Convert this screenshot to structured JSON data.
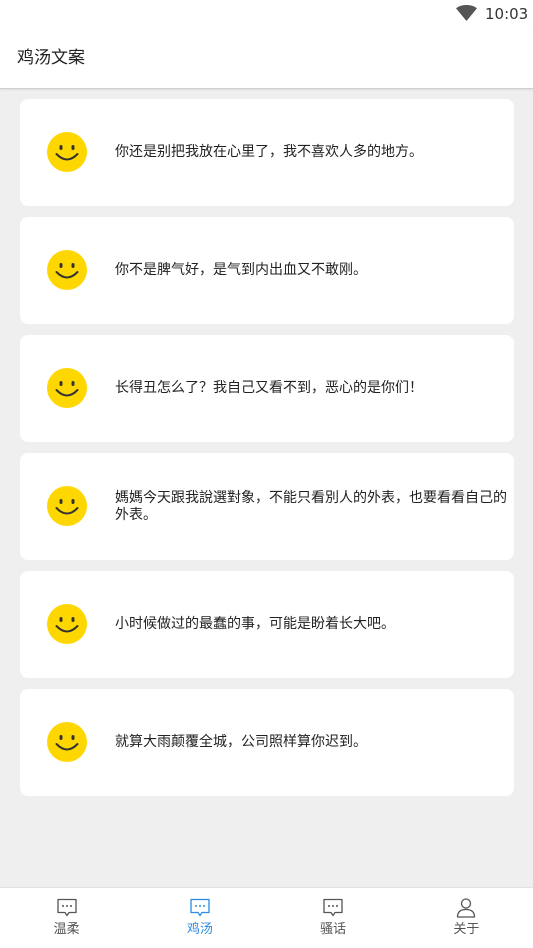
{
  "status_bar": {
    "time": "10:03",
    "wifi_icon": "wifi-icon"
  },
  "header": {
    "title": "鸡汤文案"
  },
  "cards": [
    {
      "icon": "smiley-icon",
      "text": "你还是别把我放在心里了，我不喜欢人多的地方。"
    },
    {
      "icon": "smiley-icon",
      "text": "你不是脾气好，是气到内出血又不敢刚。"
    },
    {
      "icon": "smiley-icon",
      "text": "长得丑怎么了？我自己又看不到，恶心的是你们！"
    },
    {
      "icon": "smiley-icon",
      "text": "媽媽今天跟我說選對象，不能只看別人的外表，也要看看自己的外表。"
    },
    {
      "icon": "smiley-icon",
      "text": "小时候做过的最蠢的事，可能是盼着长大吧。"
    },
    {
      "icon": "smiley-icon",
      "text": "就算大雨颠覆全城，公司照样算你迟到。"
    }
  ],
  "bottom_nav": {
    "active": "鸡汤",
    "active_color": "#2d8ae0",
    "items": [
      {
        "label": "温柔",
        "icon": "message-icon"
      },
      {
        "label": "鸡汤",
        "icon": "message-icon"
      },
      {
        "label": "骚话",
        "icon": "message-icon"
      },
      {
        "label": "关于",
        "icon": "person-icon"
      }
    ]
  }
}
